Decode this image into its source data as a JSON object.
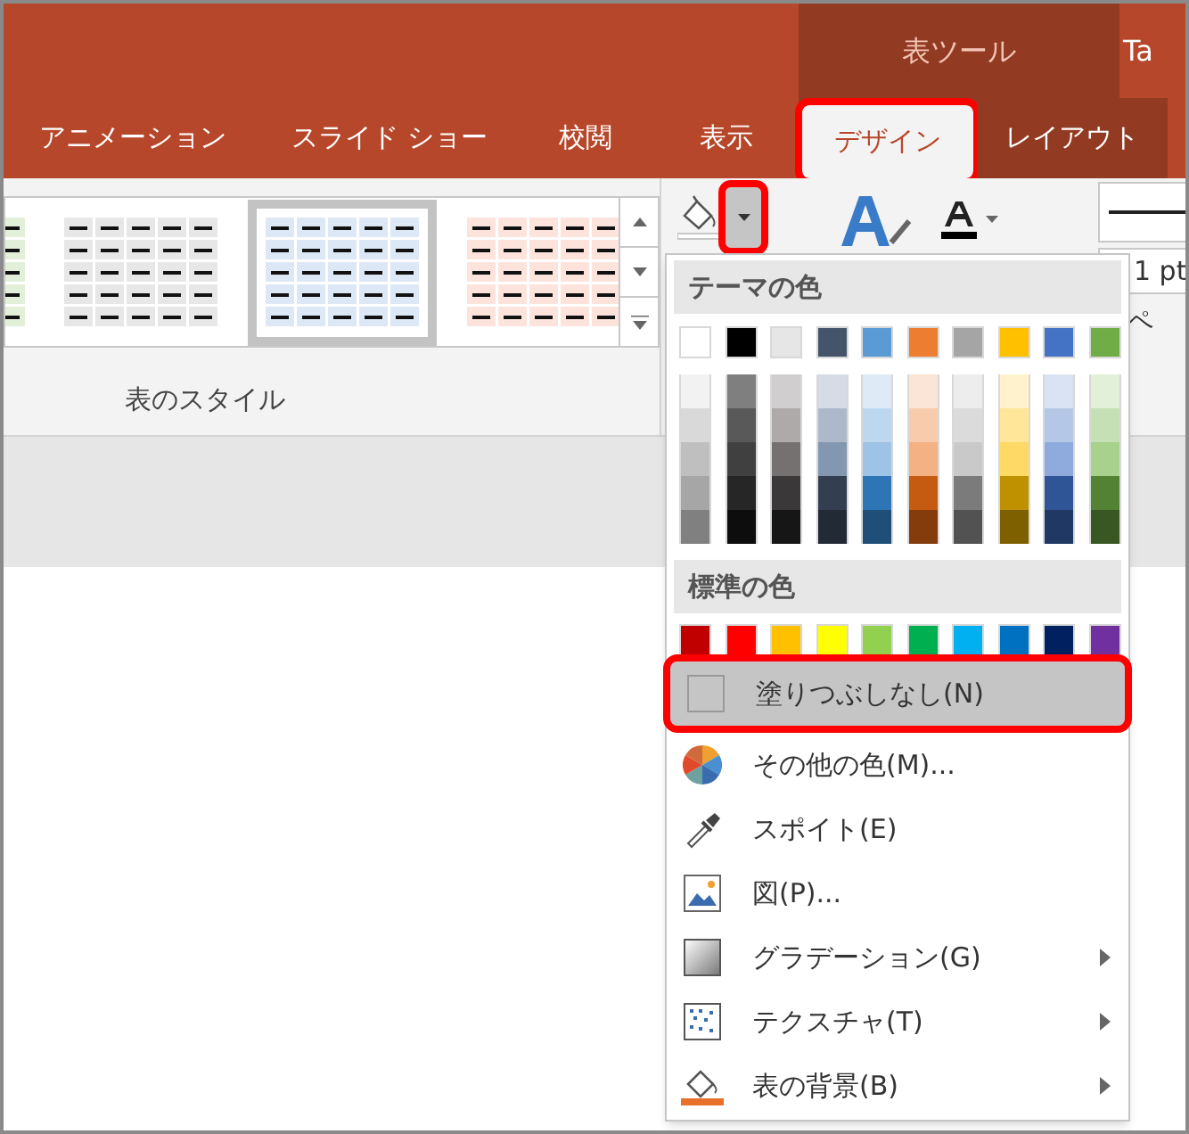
{
  "title_bar": {
    "context_group": "表ツール",
    "cut_tab": "Ta"
  },
  "tabs": [
    {
      "label": "アニメーション",
      "selected": false,
      "contextual": false,
      "highlighted": false
    },
    {
      "label": "スライド ショー",
      "selected": false,
      "contextual": false,
      "highlighted": false
    },
    {
      "label": "校閲",
      "selected": false,
      "contextual": false,
      "highlighted": false
    },
    {
      "label": "表示",
      "selected": false,
      "contextual": false,
      "highlighted": false
    },
    {
      "label": "デザイン",
      "selected": true,
      "contextual": true,
      "highlighted": true
    },
    {
      "label": "レイアウト",
      "selected": false,
      "contextual": true,
      "highlighted": false
    }
  ],
  "ribbon": {
    "group_label": "表のスタイル",
    "table_styles": [
      {
        "color": "#e2f0d9",
        "selected": false
      },
      {
        "color": "#e7e7e7",
        "selected": false
      },
      {
        "color": "#dde8f6",
        "selected": true
      },
      {
        "color": "#fce4dc",
        "selected": false
      }
    ],
    "fill_dropdown_highlighted": true,
    "pen_weight": "1 pt",
    "pen_label": "ペ"
  },
  "fill_menu": {
    "theme_header": "テーマの色",
    "theme_colors": [
      {
        "color": "#ffffff",
        "shades": [
          {
            "color": "#f2f2f2"
          },
          {
            "color": "#d9d9d9"
          },
          {
            "color": "#bfbfbf"
          },
          {
            "color": "#a6a6a6"
          },
          {
            "color": "#808080"
          }
        ]
      },
      {
        "color": "#000000",
        "shades": [
          {
            "color": "#7f7f7f"
          },
          {
            "color": "#595959"
          },
          {
            "color": "#404040"
          },
          {
            "color": "#262626"
          },
          {
            "color": "#0d0d0d"
          }
        ]
      },
      {
        "color": "#e7e6e6",
        "shades": [
          {
            "color": "#d0cece"
          },
          {
            "color": "#aeaaaa"
          },
          {
            "color": "#757171"
          },
          {
            "color": "#3a3838"
          },
          {
            "color": "#171616"
          }
        ]
      },
      {
        "color": "#44546a",
        "shades": [
          {
            "color": "#d6dce5"
          },
          {
            "color": "#adb9ca"
          },
          {
            "color": "#8497b0"
          },
          {
            "color": "#333f50"
          },
          {
            "color": "#222a35"
          }
        ]
      },
      {
        "color": "#5b9bd5",
        "shades": [
          {
            "color": "#deebf7"
          },
          {
            "color": "#bdd7ee"
          },
          {
            "color": "#9dc3e6"
          },
          {
            "color": "#2e75b6"
          },
          {
            "color": "#1f4e79"
          }
        ]
      },
      {
        "color": "#ed7d31",
        "shades": [
          {
            "color": "#fbe5d6"
          },
          {
            "color": "#f8cbad"
          },
          {
            "color": "#f4b183"
          },
          {
            "color": "#c55a11"
          },
          {
            "color": "#843c0c"
          }
        ]
      },
      {
        "color": "#a5a5a5",
        "shades": [
          {
            "color": "#ededed"
          },
          {
            "color": "#dbdbdb"
          },
          {
            "color": "#c9c9c9"
          },
          {
            "color": "#7b7b7b"
          },
          {
            "color": "#525252"
          }
        ]
      },
      {
        "color": "#ffc000",
        "shades": [
          {
            "color": "#fff2cc"
          },
          {
            "color": "#ffe699"
          },
          {
            "color": "#ffd966"
          },
          {
            "color": "#bf9000"
          },
          {
            "color": "#7f6000"
          }
        ]
      },
      {
        "color": "#4472c4",
        "shades": [
          {
            "color": "#dae3f3"
          },
          {
            "color": "#b4c7e7"
          },
          {
            "color": "#8faadc"
          },
          {
            "color": "#2f5597"
          },
          {
            "color": "#203864"
          }
        ]
      },
      {
        "color": "#70ad47",
        "shades": [
          {
            "color": "#e2f0d9"
          },
          {
            "color": "#c5e0b4"
          },
          {
            "color": "#a9d18e"
          },
          {
            "color": "#548235"
          },
          {
            "color": "#385723"
          }
        ]
      }
    ],
    "standard_header": "標準の色",
    "standard_colors": [
      {
        "color": "#c00000"
      },
      {
        "color": "#ff0000"
      },
      {
        "color": "#ffc000"
      },
      {
        "color": "#ffff00"
      },
      {
        "color": "#92d050"
      },
      {
        "color": "#00b050"
      },
      {
        "color": "#00b0f0"
      },
      {
        "color": "#0070c0"
      },
      {
        "color": "#002060"
      },
      {
        "color": "#7030a0"
      }
    ],
    "items": [
      {
        "kind": "none",
        "label": "塗りつぶしなし(N)",
        "hovered": true,
        "highlighted": true,
        "submenu": false
      },
      {
        "kind": "more",
        "label": "その他の色(M)...",
        "hovered": false,
        "highlighted": false,
        "submenu": false
      },
      {
        "kind": "eyedropper",
        "label": "スポイト(E)",
        "hovered": false,
        "highlighted": false,
        "submenu": false
      },
      {
        "kind": "picture",
        "label": "図(P)...",
        "hovered": false,
        "highlighted": false,
        "submenu": false
      },
      {
        "kind": "gradient",
        "label": "グラデーション(G)",
        "hovered": false,
        "highlighted": false,
        "submenu": true
      },
      {
        "kind": "texture",
        "label": "テクスチャ(T)",
        "hovered": false,
        "highlighted": false,
        "submenu": true
      },
      {
        "kind": "background",
        "label": "表の背景(B)",
        "hovered": false,
        "highlighted": false,
        "submenu": true
      }
    ]
  }
}
